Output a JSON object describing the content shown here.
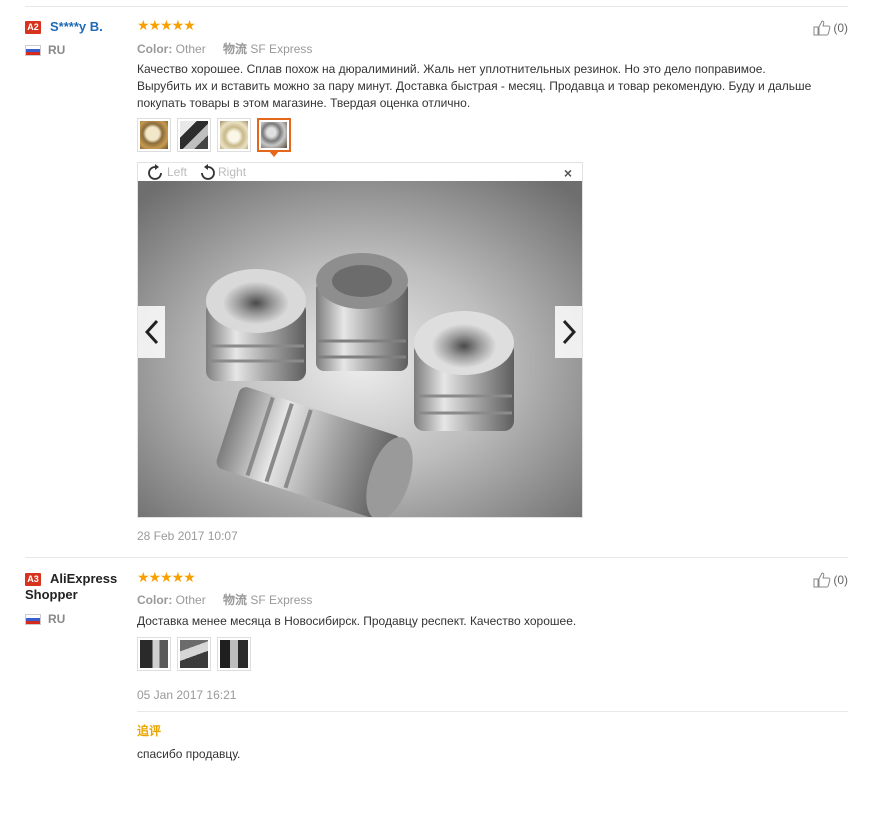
{
  "reviews": [
    {
      "badge": "A2",
      "user": "S****y B.",
      "country": "RU",
      "stars": "★★★★★",
      "color_label": "Color:",
      "color_value": "Other",
      "logistics_label": "物流",
      "logistics_value": "SF Express",
      "text": "Качество хорошее. Сплав похож на дюралиминий. Жаль нет уплотнительных резинок. Но это дело поправимое. Вырубить их и вставить можно за пару минут. Доставка быстрая - месяц. Продавца и товар рекомендую. Буду и дальше покупать товары в этом магазине. Твердая оценка отлично.",
      "likes": "(0)",
      "date": "28 Feb 2017 10:07",
      "viewer": {
        "left_label": "Left",
        "right_label": "Right",
        "close": "×"
      }
    },
    {
      "badge": "A3",
      "user": "AliExpress Shopper",
      "country": "RU",
      "stars": "★★★★★",
      "color_label": "Color:",
      "color_value": "Other",
      "logistics_label": "物流",
      "logistics_value": "SF Express",
      "text": "Доставка менее месяца в Новосибирск. Продавцу респект. Качество хорошее.",
      "likes": "(0)",
      "date": "05 Jan 2017 16:21",
      "followup_label": "追评",
      "followup_text": "спасибо продавцу."
    }
  ],
  "icons": {
    "like": "thumbs-up-icon",
    "rotate_left": "rotate-left-icon",
    "rotate_right": "rotate-right-icon",
    "prev": "chevron-left-icon",
    "next": "chevron-right-icon",
    "close": "close-icon"
  },
  "colors": {
    "stars": "#f7a000",
    "badge": "#d7341f",
    "username": "#1d6bb5",
    "followup": "#e8a500",
    "active_thumb": "#e5671c"
  }
}
